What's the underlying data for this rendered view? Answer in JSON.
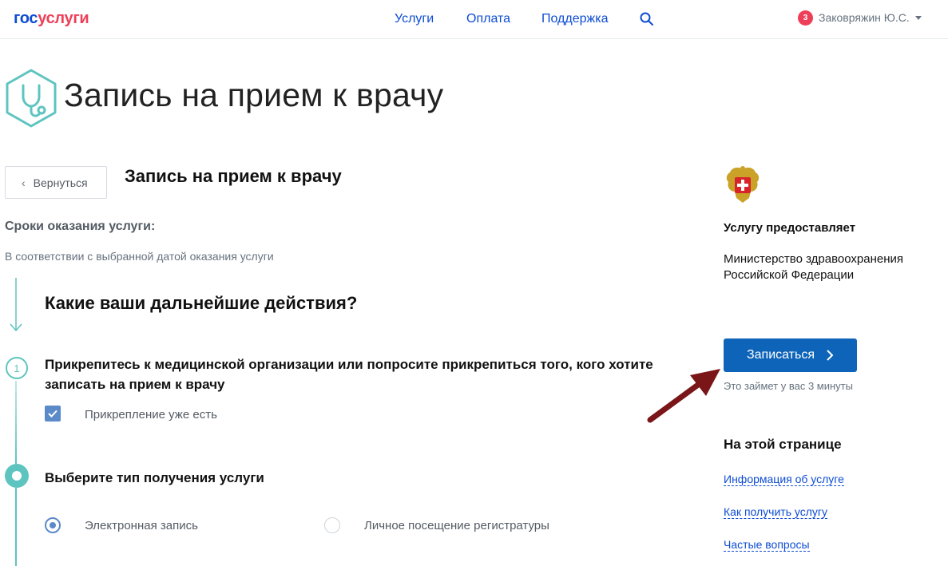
{
  "header": {
    "logo_part1": "гос",
    "logo_part2": "услуги",
    "nav": [
      "Услуги",
      "Оплата",
      "Поддержка"
    ],
    "notifications_count": "3",
    "user_name": "Заковряжин Ю.С."
  },
  "page": {
    "title": "Запись на прием к врачу",
    "back_label": "Вернуться",
    "subtitle": "Запись на прием к врачу",
    "terms_heading": "Сроки оказания услуги:",
    "terms_text": "В соответствии с выбранной датой оказания услуги",
    "question": "Какие ваши дальнейшие действия?"
  },
  "steps": [
    {
      "number": "1",
      "text": "Прикрепитесь к медицинской организации или попросите прикрепиться того, кого хотите записать на прием к врачу",
      "checkbox_label": "Прикрепление уже есть",
      "checked": true
    },
    {
      "text": "Выберите тип получения услуги",
      "options": [
        {
          "label": "Электронная запись",
          "selected": true
        },
        {
          "label": "Личное посещение регистратуры",
          "selected": false
        }
      ]
    }
  ],
  "sidebar": {
    "provider_heading": "Услугу предоставляет",
    "provider_name": "Министерство здравоохранения Российской Федерации",
    "cta_label": "Записаться",
    "cta_hint": "Это займет у вас 3 минуты",
    "toc_heading": "На этой странице",
    "toc_links": [
      "Информация об услуге",
      "Как получить услугу",
      "Частые вопросы"
    ]
  },
  "colors": {
    "brand_blue": "#0d4cd3",
    "brand_red": "#ee3f58",
    "teal": "#5ec4c0",
    "button_blue": "#0d64b8",
    "annotation_arrow": "#7a1518"
  },
  "icons": [
    "search-icon",
    "stethoscope-icon",
    "chevron-left-icon",
    "chevron-right-icon",
    "check-icon",
    "emblem-icon",
    "down-arrow-icon",
    "caret-down-icon"
  ]
}
